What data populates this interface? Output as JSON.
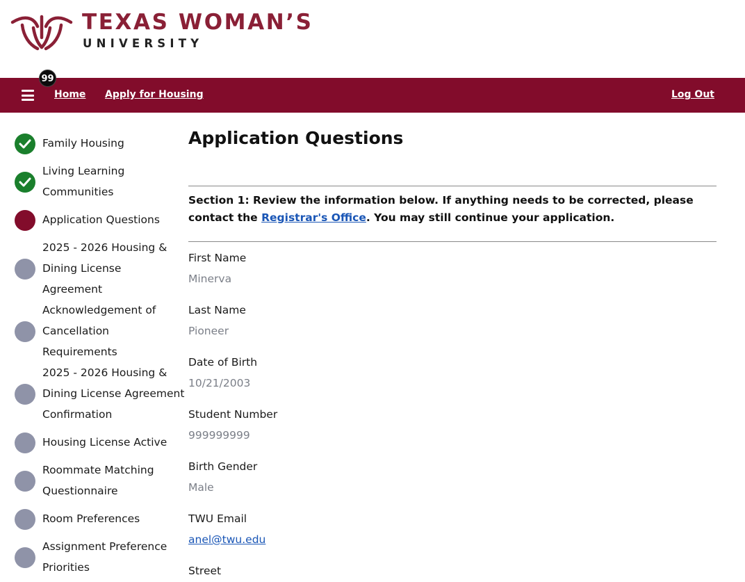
{
  "brand": {
    "title": "TEXAS WOMAN’S",
    "subtitle": "UNIVERSITY",
    "color": "#8a2036"
  },
  "nav": {
    "badge": "99",
    "home_label": "Home",
    "apply_label": "Apply for Housing",
    "logout_label": "Log Out",
    "bar_color": "#820c2b"
  },
  "sidebar": {
    "steps": [
      {
        "label": "Family Housing",
        "status": "complete"
      },
      {
        "label": "Living Learning Communities",
        "status": "complete"
      },
      {
        "label": "Application Questions",
        "status": "current"
      },
      {
        "label": "2025 - 2026 Housing & Dining License Agreement",
        "status": "pending"
      },
      {
        "label": "Acknowledgement of Cancellation Requirements",
        "status": "pending"
      },
      {
        "label": "2025 - 2026 Housing & Dining License Agreement Confirmation",
        "status": "pending"
      },
      {
        "label": "Housing License Active",
        "status": "pending"
      },
      {
        "label": "Roommate Matching Questionnaire",
        "status": "pending"
      },
      {
        "label": "Room Preferences",
        "status": "pending"
      },
      {
        "label": "Assignment Preference Priorities",
        "status": "pending"
      }
    ]
  },
  "main": {
    "title": "Application Questions",
    "section1": {
      "before": "Section 1: Review the information below. If anything needs to be corrected, please contact the ",
      "link": "Registrar's Office",
      "after": ". You may still continue your application."
    },
    "fields": [
      {
        "label": "First Name",
        "value": "Minerva"
      },
      {
        "label": "Last Name",
        "value": "Pioneer"
      },
      {
        "label": "Date of Birth",
        "value": "10/21/2003"
      },
      {
        "label": "Student Number",
        "value": "999999999"
      },
      {
        "label": "Birth Gender",
        "value": "Male"
      },
      {
        "label": "TWU Email",
        "value": "anel@twu.edu"
      },
      {
        "label": "Street",
        "value": ""
      }
    ]
  }
}
